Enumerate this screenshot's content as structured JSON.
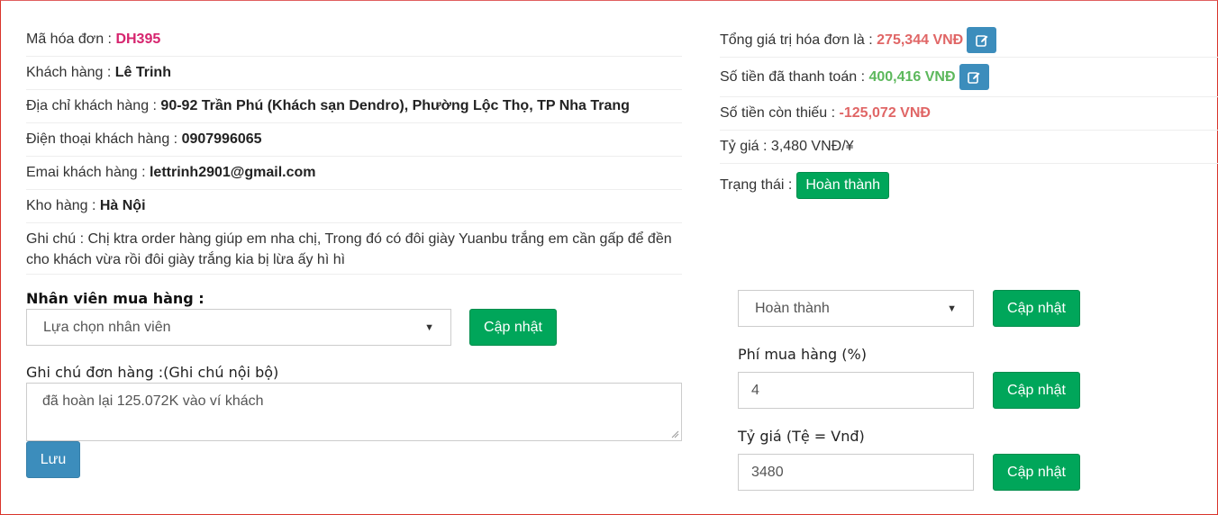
{
  "invoice": {
    "code_label": "Mã hóa đơn : ",
    "code": "DH395",
    "customer_label": "Khách hàng : ",
    "customer": "Lê Trinh",
    "address_label": "Địa chỉ khách hàng : ",
    "address": "90-92 Trần Phú (Khách sạn Dendro), Phường Lộc Thọ, TP Nha Trang",
    "phone_label": "Điện thoại khách hàng : ",
    "phone": "0907996065",
    "email_label": "Emai khách hàng : ",
    "email": "lettrinh2901@gmail.com",
    "warehouse_label": "Kho hàng : ",
    "warehouse": "Hà Nội",
    "note_label": "Ghi chú : ",
    "note": "Chị ktra order hàng giúp em nha chị, Trong đó có đôi giày Yuanbu trắng em cần gấp để đền cho khách vừa rồi đôi giày trắng kia bị lừa ấy hì hì"
  },
  "summary": {
    "total_label": "Tổng giá trị hóa đơn là : ",
    "total": "275,344 VNĐ",
    "paid_label": "Số tiền đã thanh toán : ",
    "paid": "400,416 VNĐ",
    "owed_label": "Số tiền còn thiếu : ",
    "owed": "-125,072 VNĐ",
    "rate_label": "Tỷ giá : ",
    "rate": "3,480 VNĐ/¥",
    "status_label": "Trạng thái : ",
    "status": "Hoàn thành"
  },
  "staff": {
    "label": "Nhân viên mua hàng :",
    "select_value": "Lựa chọn nhân viên",
    "update_label": "Cập nhật"
  },
  "internal_note": {
    "label": "Ghi chú đơn hàng :(Ghi chú nội bộ)",
    "value": "đã hoàn lại 125.072K vào ví khách",
    "save_label": "Lưu"
  },
  "status_form": {
    "select_value": "Hoàn thành",
    "update_label": "Cập nhật"
  },
  "fee_form": {
    "label": "Phí mua hàng (%)",
    "value": "4",
    "update_label": "Cập nhật"
  },
  "rate_form": {
    "label": "Tỷ giá (Tệ = Vnđ)",
    "value": "3480",
    "update_label": "Cập nhật"
  },
  "colors": {
    "accent_green": "#00a65a",
    "accent_blue": "#3c8dbc",
    "order_code": "#d6246e",
    "negative": "#e06666",
    "positive": "#5cb85c"
  },
  "icons": {
    "edit": "edit-icon",
    "caret": "chevron-down-icon"
  }
}
